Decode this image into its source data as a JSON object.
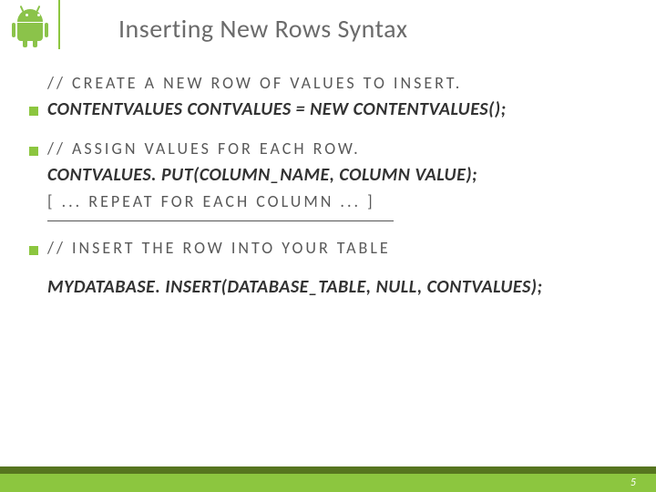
{
  "title": "Inserting New Rows Syntax",
  "lines": {
    "c1": "// CREATE A NEW ROW OF VALUES TO INSERT.",
    "s1": "CONTENTVALUES CONTVALUES = NEW CONTENTVALUES();",
    "c2": "// ASSIGN VALUES FOR EACH ROW.",
    "s2": "CONTVALUES. PUT(COLUMN_NAME, COLUMN VALUE);",
    "c3": "[ ... REPEAT FOR EACH COLUMN ... ]",
    "c4": "// INSERT THE ROW INTO YOUR TABLE",
    "s3": "MYDATABASE. INSERT(DATABASE_TABLE, NULL, CONTVALUES);"
  },
  "page_number": "5"
}
